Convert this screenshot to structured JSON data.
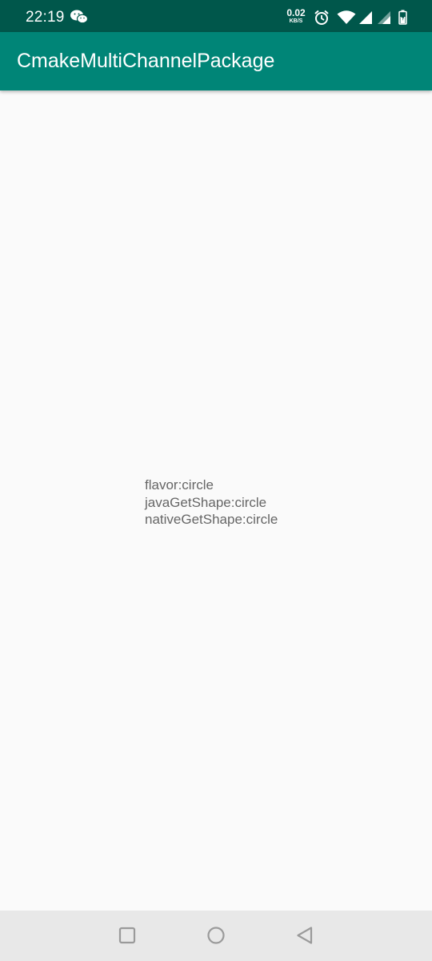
{
  "status_bar": {
    "time": "22:19",
    "net_speed_value": "0.02",
    "net_speed_unit": "KB/S",
    "icons": [
      "wechat-icon",
      "alarm-icon",
      "wifi-icon",
      "signal-icon",
      "signal-icon-2",
      "battery-icon"
    ]
  },
  "app_bar": {
    "title": "CmakeMultiChannelPackage"
  },
  "content": {
    "lines": [
      "flavor:circle",
      "javaGetShape:circle",
      "nativeGetShape:circle"
    ]
  },
  "nav_bar": {
    "buttons": [
      "recents-button",
      "home-button",
      "back-button"
    ]
  },
  "colors": {
    "status_bar": "#00574b",
    "app_bar": "#008577",
    "background": "#fafafa",
    "text": "#666666",
    "nav_bar": "#e8e8e8"
  }
}
